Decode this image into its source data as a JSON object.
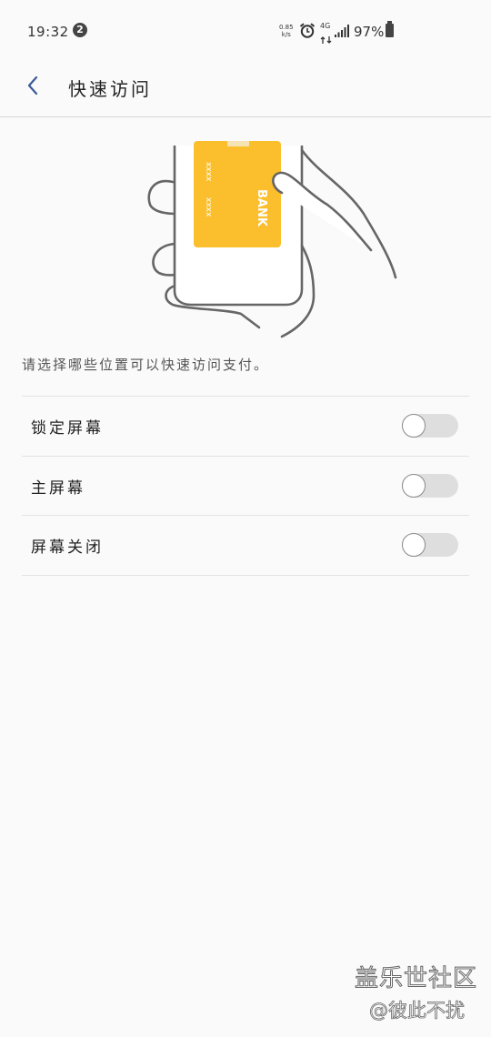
{
  "status_bar": {
    "time": "19:32",
    "alarm_badge": "2",
    "net_speed_value": "0.85",
    "net_speed_unit": "k/s",
    "network": "4G",
    "battery": "97%"
  },
  "header": {
    "title": "快速访问"
  },
  "illustration": {
    "card_label": "BANK",
    "card_number_a": "xxxx",
    "card_number_b": "xxxx",
    "card_color": "#fbbf2d"
  },
  "description": "请选择哪些位置可以快速访问支付。",
  "settings": [
    {
      "label": "锁定屏幕",
      "enabled": false
    },
    {
      "label": "主屏幕",
      "enabled": false
    },
    {
      "label": "屏幕关闭",
      "enabled": false
    }
  ],
  "watermark": {
    "title": "盖乐世社区",
    "subtitle": "@彼此不扰"
  }
}
